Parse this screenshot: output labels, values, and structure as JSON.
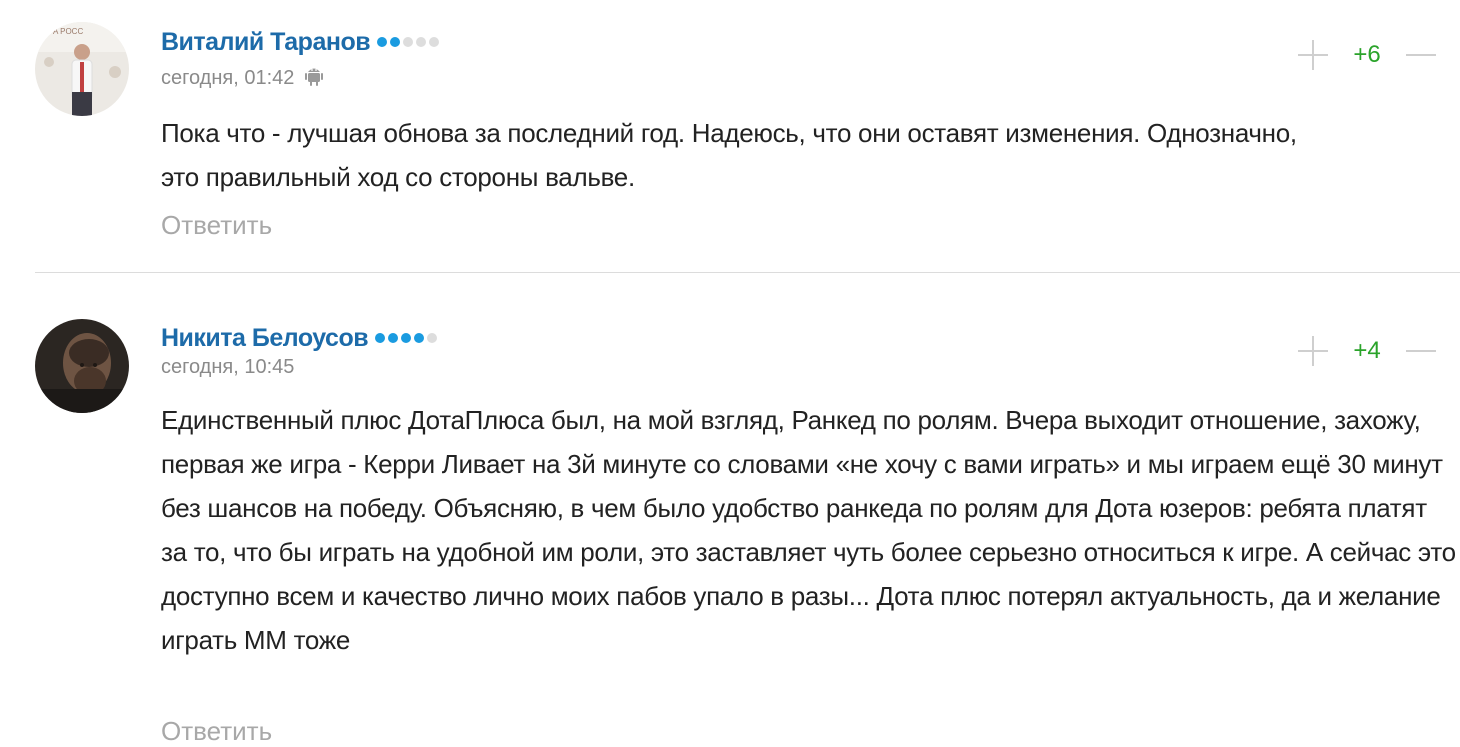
{
  "comments": [
    {
      "author": "Виталий Таранов",
      "rating_dots_filled": 2,
      "rating_dots_total": 5,
      "time": "сегодня, 01:42",
      "device_icon": "android-icon",
      "score": "+6",
      "text": "Пока что - лучшая обнова за последний год. Надеюсь, что они оставят изменения. Однозначно, это правильный ход со стороны вальве.",
      "reply_label": "Ответить"
    },
    {
      "author": "Никита Белоусов",
      "rating_dots_filled": 4,
      "rating_dots_total": 5,
      "time": "сегодня, 10:45",
      "score": "+4",
      "text": "Единственный плюс ДотаПлюса был, на мой взгляд, Ранкед по ролям. Вчера выходит отношение, захожу, первая же игра - Керри Ливает на 3й минуте со словами «не хочу с вами играть» и мы играем ещё 30 минут без шансов на победу. Объясняю, в чем было удобство ранкеда по ролям для Дота юзеров: ребята платят за то, что бы играть на удобной им роли, это заставляет чуть более серьезно относиться к игре. А сейчас это доступно всем и качество лично моих пабов упало в разы... Дота плюс потерял актуальность, да и желание играть ММ тоже",
      "reply_label": "Ответить"
    }
  ],
  "colors": {
    "author": "#1d6ba9",
    "dot_on": "#1a9be0",
    "dot_off": "#dddddd",
    "score": "#2aa32a",
    "meta": "#8a8a8a",
    "reply": "#a8a8a8",
    "vote_icon": "#cfcfcf"
  }
}
